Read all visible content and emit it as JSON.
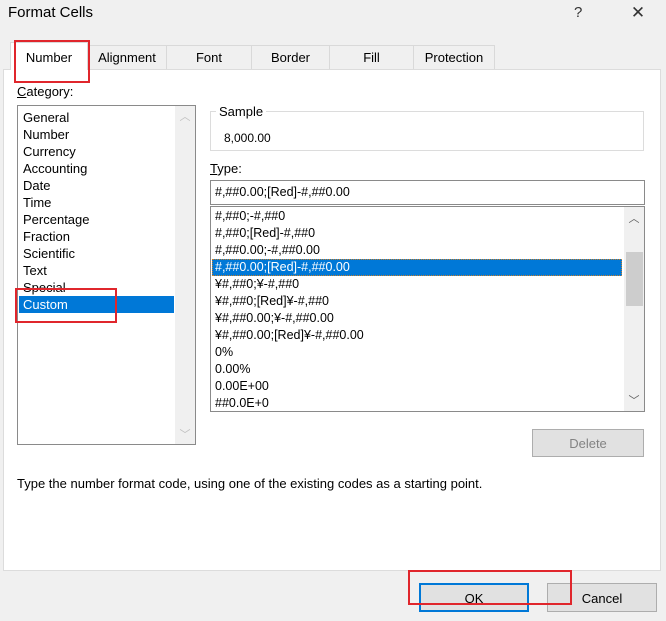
{
  "window": {
    "title": "Format Cells",
    "help_label": "?",
    "close_icon": "close-icon"
  },
  "tabs": [
    {
      "label": "Number",
      "active": true
    },
    {
      "label": "Alignment",
      "active": false
    },
    {
      "label": "Font",
      "active": false
    },
    {
      "label": "Border",
      "active": false
    },
    {
      "label": "Fill",
      "active": false
    },
    {
      "label": "Protection",
      "active": false
    }
  ],
  "category": {
    "label_accel": "C",
    "label_rest": "ategory:",
    "items": [
      "General",
      "Number",
      "Currency",
      "Accounting",
      "Date",
      "Time",
      "Percentage",
      "Fraction",
      "Scientific",
      "Text",
      "Special",
      "Custom"
    ],
    "selected": "Custom"
  },
  "sample": {
    "title": "Sample",
    "value": "8,000.00"
  },
  "type": {
    "label_accel": "T",
    "label_rest": "ype:",
    "value": "#,##0.00;[Red]-#,##0.00",
    "items": [
      "#,##0;-#,##0",
      "#,##0;[Red]-#,##0",
      "#,##0.00;-#,##0.00",
      "#,##0.00;[Red]-#,##0.00",
      "¥#,##0;¥-#,##0",
      "¥#,##0;[Red]¥-#,##0",
      "¥#,##0.00;¥-#,##0.00",
      "¥#,##0.00;[Red]¥-#,##0.00",
      "0%",
      "0.00%",
      "0.00E+00",
      "##0.0E+0"
    ],
    "selected_index": 3
  },
  "buttons": {
    "delete": "Delete",
    "ok": "OK",
    "cancel": "Cancel"
  },
  "description": "Type the number format code, using one of the existing codes as a starting point.",
  "colors": {
    "selection": "#0078d7",
    "annotation_red": "#e0262c",
    "focus_blue": "#0078d7"
  }
}
